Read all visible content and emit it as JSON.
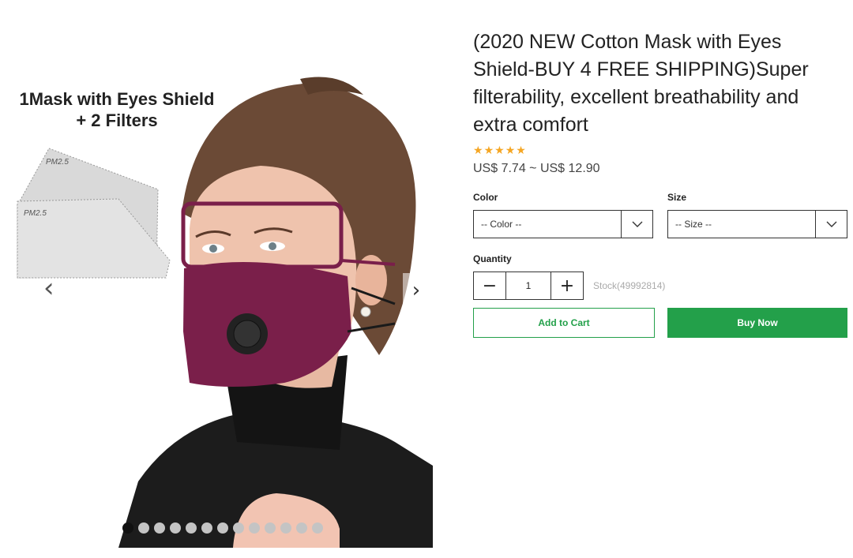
{
  "gallery": {
    "promo_line1": "1Mask with Eyes Shield",
    "promo_line2": "+ 2 Filters",
    "filter_label_1": "PM2.5",
    "filter_label_2": "PM2.5",
    "image_count": 13,
    "active_index": 0
  },
  "product": {
    "title": "(2020 NEW Cotton Mask with Eyes Shield-BUY 4 FREE SHIPPING)Super filterability, excellent breathability and extra comfort",
    "rating": 5,
    "price": "US$ 7.74 ~ US$ 12.90"
  },
  "options": {
    "color_label": "Color",
    "color_value": "-- Color --",
    "size_label": "Size",
    "size_value": "-- Size --"
  },
  "quantity": {
    "label": "Quantity",
    "value": "1",
    "minus": "−",
    "plus": "+",
    "stock": "Stock(49992814)"
  },
  "actions": {
    "add_to_cart": "Add to Cart",
    "buy_now": "Buy Now"
  },
  "colors": {
    "accent": "#23a04a",
    "star": "#f5a623",
    "mask": "#7a1f4a"
  }
}
